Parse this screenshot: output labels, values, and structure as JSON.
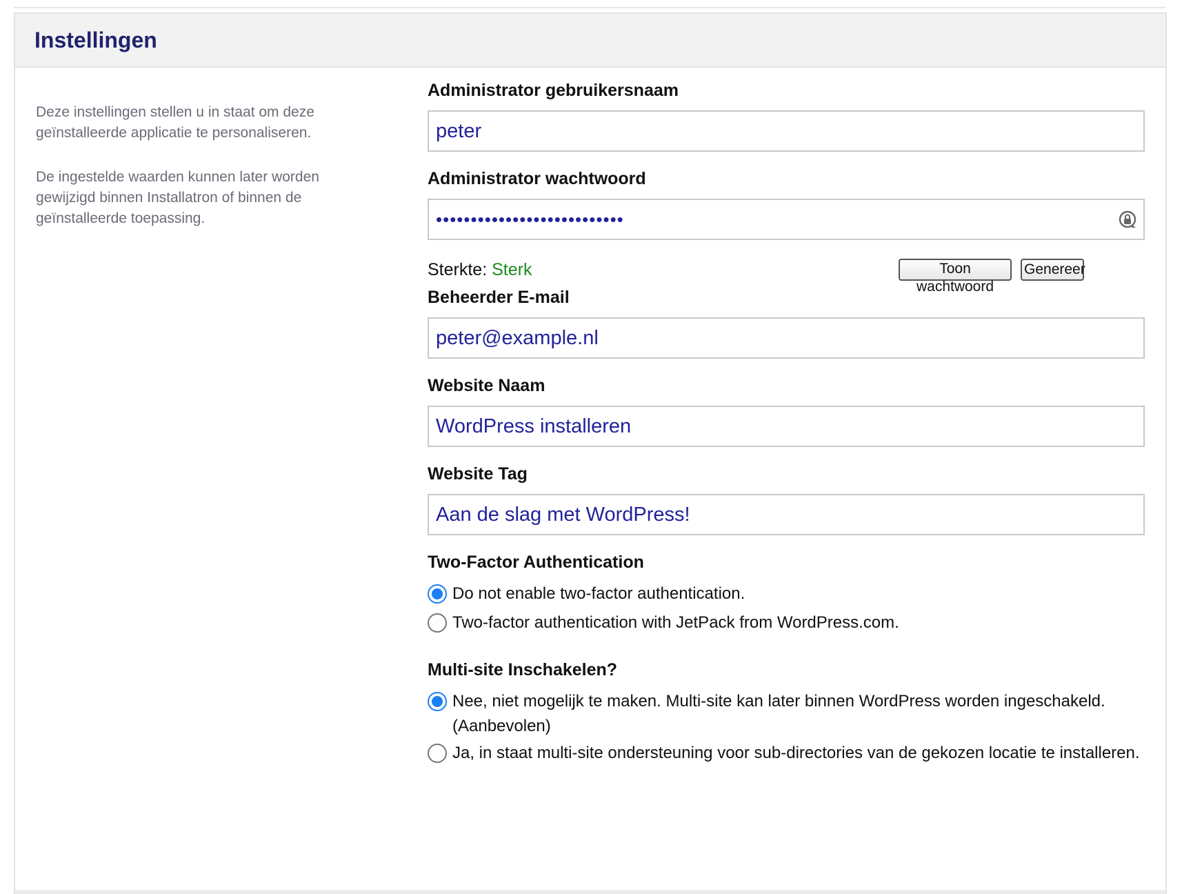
{
  "panel": {
    "title": "Instellingen"
  },
  "description": {
    "paragraphs": [
      "Deze instellingen stellen u in staat om deze geïnstalleerde applicatie te personaliseren.",
      "De ingestelde waarden kunnen later worden gewijzigd binnen Installatron of binnen de geïnstalleerde toepassing."
    ]
  },
  "fields": {
    "admin_username": {
      "label": "Administrator gebruikersnaam",
      "value": "peter"
    },
    "admin_password": {
      "label": "Administrator wachtwoord",
      "value": "•••••••••••••••••••••••••••",
      "icon": "password-manager-icon"
    },
    "strength": {
      "label": "Sterkte:",
      "value": "Sterk"
    },
    "show_password_button": "Toon wachtwoord",
    "generate_button": "Genereer",
    "admin_email": {
      "label": "Beheerder E-mail",
      "value": "peter@example.nl"
    },
    "site_name": {
      "label": "Website Naam",
      "value": "WordPress installeren"
    },
    "site_tag": {
      "label": "Website Tag",
      "value": "Aan de slag met WordPress!"
    }
  },
  "two_factor": {
    "label": "Two-Factor Authentication",
    "options": [
      {
        "text": "Do not enable two-factor authentication.",
        "selected": true
      },
      {
        "text": "Two-factor authentication with JetPack from WordPress.com.",
        "selected": false
      }
    ]
  },
  "multisite": {
    "label": "Multi-site Inschakelen?",
    "options": [
      {
        "text": "Nee, niet mogelijk te maken. Multi-site kan later binnen WordPress worden ingeschakeld. (Aanbevolen)",
        "selected": true
      },
      {
        "text": "Ja, in staat multi-site ondersteuning voor sub-directories van de gekozen locatie te installeren.",
        "selected": false
      }
    ]
  },
  "colors": {
    "title": "#22226e",
    "input_text": "#22229a",
    "strength_ok": "#1e8a1e",
    "radio_accent": "#1a7ff5"
  }
}
